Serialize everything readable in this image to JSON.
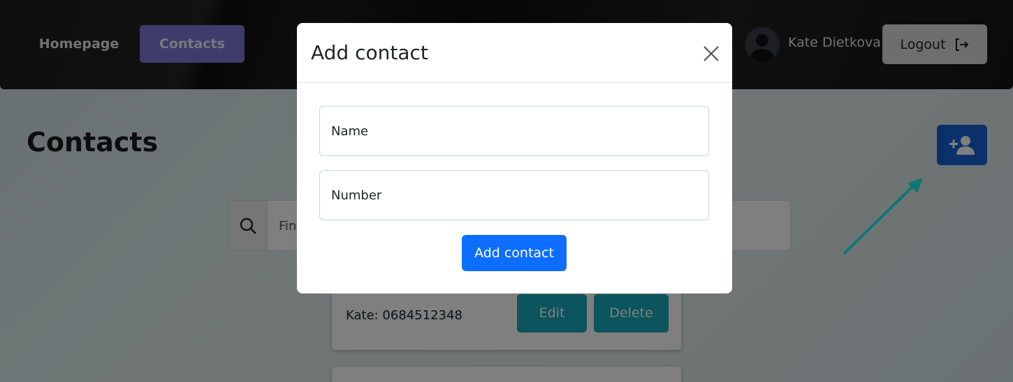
{
  "navbar": {
    "home_label": "Homepage",
    "contacts_label": "Contacts",
    "user_name": "Kate Dietkova",
    "logout_label": "Logout"
  },
  "page": {
    "title": "Contacts",
    "search_placeholder": "Fin"
  },
  "contacts": [
    {
      "text": "Kate: 0684512348",
      "edit_label": "Edit",
      "delete_label": "Delete"
    }
  ],
  "modal": {
    "title": "Add contact",
    "name_label": "Name",
    "number_label": "Number",
    "submit_label": "Add contact"
  },
  "colors": {
    "primary": "#0d6efd",
    "nav_active": "#7b79d6",
    "card_button": "#19a9bd",
    "annotation_arrow": "#19f0e8"
  },
  "icons": {
    "search": "search-icon",
    "add_user": "add-user-icon",
    "logout": "logout-icon",
    "close": "close-icon",
    "avatar": "user-avatar-icon"
  }
}
